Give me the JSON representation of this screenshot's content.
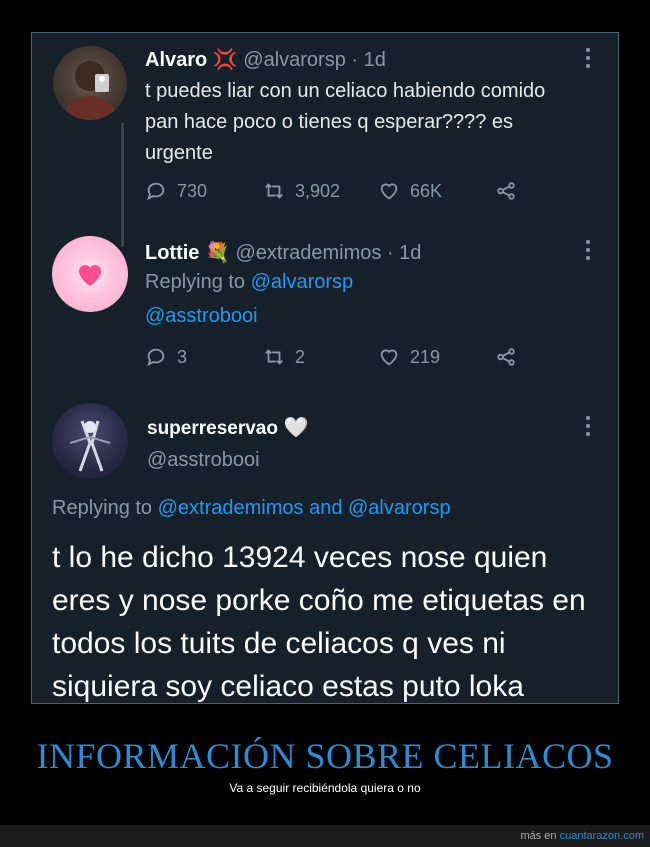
{
  "tweets": [
    {
      "name": "Alvaro",
      "emoji": "💢",
      "handle": "@alvarorsp · 1d",
      "text": "t puedes liar con un celiaco habiendo comido pan hace poco o tienes q esperar???? es urgente",
      "replies": "730",
      "retweets": "3,902",
      "likes": "66K"
    },
    {
      "name": "Lottie",
      "emoji": "💐",
      "handle": "@extrademimos · 1d",
      "replying_prefix": "Replying to ",
      "replying_to": "@alvarorsp",
      "text": "@asstrobooi",
      "replies": "3",
      "retweets": "2",
      "likes": "219"
    },
    {
      "name": "superreservao",
      "emoji": "🤍",
      "handle": "@asstrobooi",
      "replying_prefix": "Replying to ",
      "replying_to": "@extrademimos and @alvarorsp",
      "text": "t lo he dicho 13924 veces nose quien eres y nose porke coño me etiquetas en todos los tuits de celiacos q ves ni siquiera soy celiaco estas puto loka"
    }
  ],
  "headline": "INFORMACIÓN SOBRE CELIACOS",
  "subtitle": "Va a seguir recibiéndola quiera o no",
  "footer": {
    "prefix": "más en ",
    "link": "cuantarazon.com"
  },
  "colors": {
    "background": "#15202b",
    "link": "#1d9bf0",
    "muted": "#8899a6",
    "headline": "#2a8dd4"
  }
}
